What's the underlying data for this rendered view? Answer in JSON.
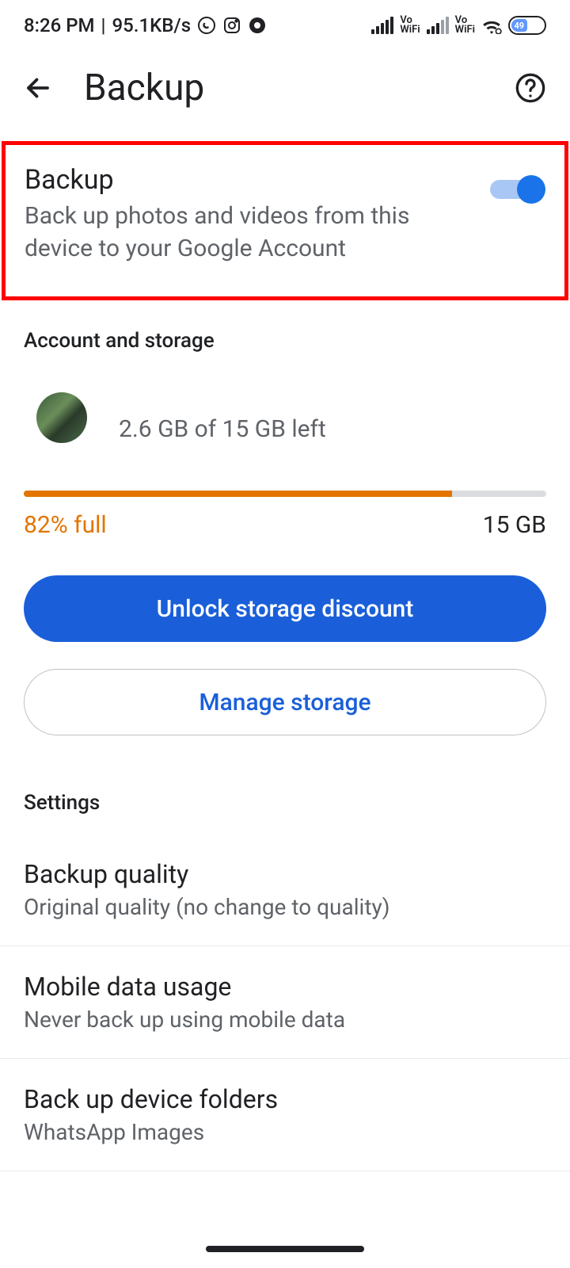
{
  "status": {
    "time": "8:26 PM",
    "speed": "95.1KB/s",
    "battery_pct": "49"
  },
  "appbar": {
    "title": "Backup"
  },
  "backup_switch": {
    "title": "Backup",
    "subtitle": "Back up photos and videos from this device to your Google Account"
  },
  "section_account": "Account and storage",
  "account": {
    "storage_text": "2.6 GB of 15 GB left"
  },
  "storage": {
    "percent_full_label": "82% full",
    "total": "15 GB"
  },
  "buttons": {
    "unlock": "Unlock storage discount",
    "manage": "Manage storage"
  },
  "section_settings": "Settings",
  "settings": [
    {
      "title": "Backup quality",
      "sub": "Original quality (no change to quality)"
    },
    {
      "title": "Mobile data usage",
      "sub": "Never back up using mobile data"
    },
    {
      "title": "Back up device folders",
      "sub": "WhatsApp Images"
    }
  ]
}
